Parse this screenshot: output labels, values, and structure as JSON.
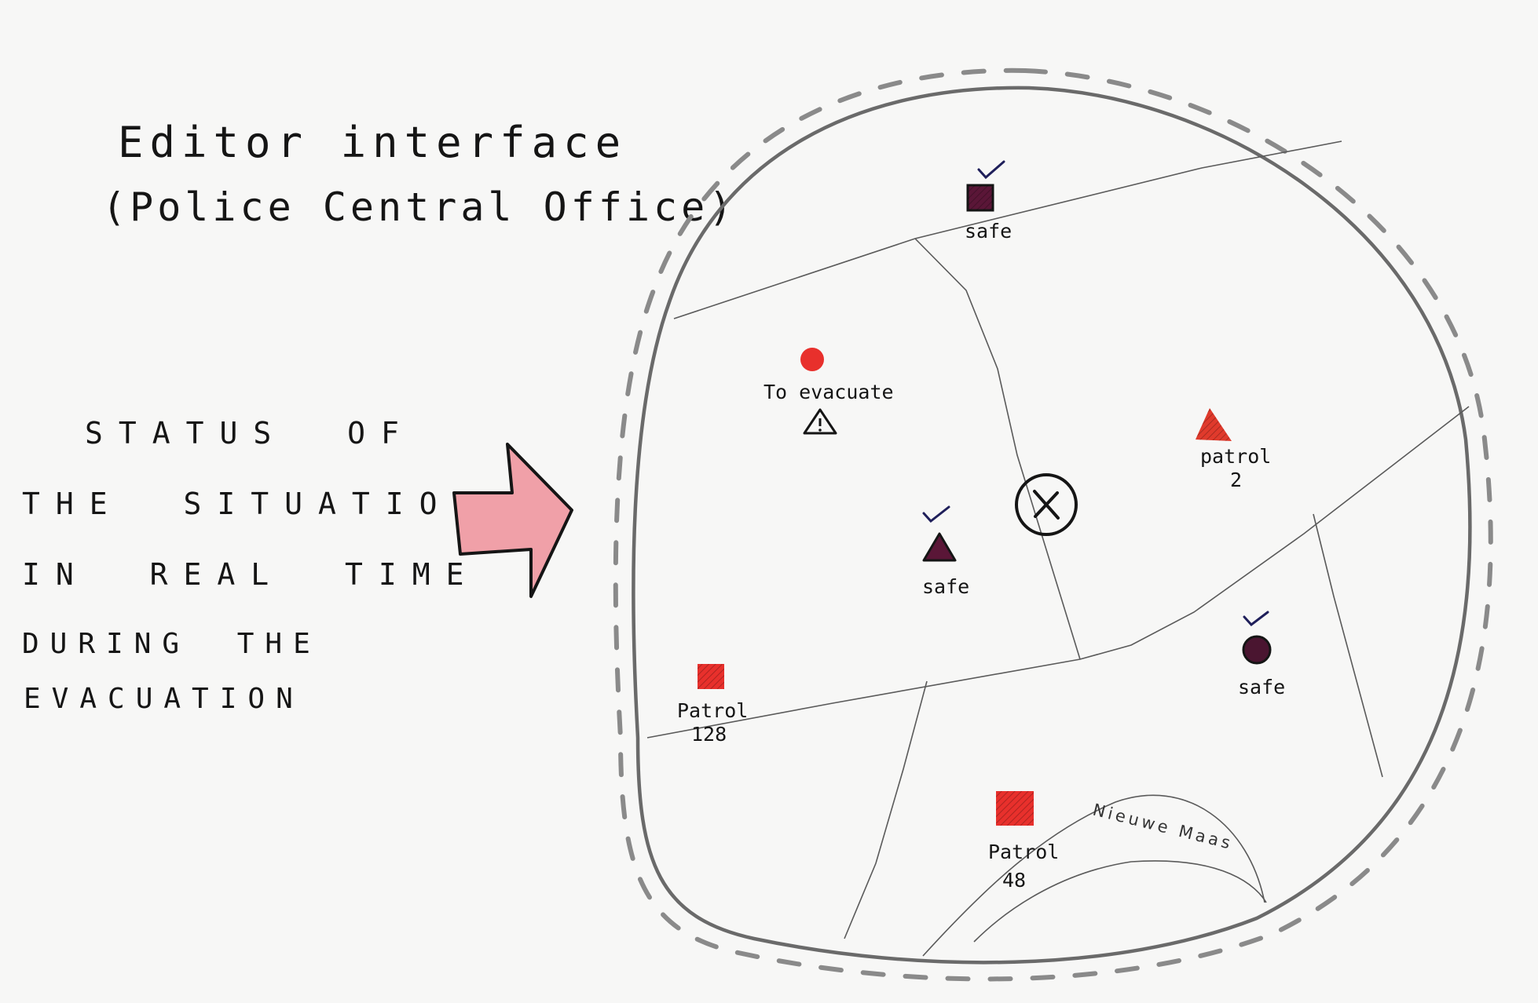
{
  "title": {
    "line1": "Editor interface",
    "line2": "(Police Central Office)"
  },
  "status_text": [
    "STATUS OF",
    "THE SITUATION",
    "IN REAL TIME",
    "DURING THE",
    "EVACUATION"
  ],
  "map": {
    "road_label": "Nieuwe Maas",
    "markers": [
      {
        "id": "safe-top",
        "shape": "square",
        "color": "#5a1637",
        "checked": true,
        "label": [
          "safe"
        ]
      },
      {
        "id": "to-evacuate",
        "shape": "circle",
        "color": "#e8302c",
        "checked": false,
        "warning": true,
        "label": [
          "To evacuate"
        ]
      },
      {
        "id": "patrol-2",
        "shape": "triangle",
        "color": "#e03a2c",
        "checked": false,
        "label": [
          "patrol",
          "2"
        ]
      },
      {
        "id": "safe-center",
        "shape": "triangle",
        "color": "#5a1637",
        "checked": true,
        "label": [
          "safe"
        ]
      },
      {
        "id": "safe-right",
        "shape": "circle",
        "color": "#4a1530",
        "checked": true,
        "label": [
          "safe"
        ]
      },
      {
        "id": "patrol-128",
        "shape": "square",
        "color": "#e8302c",
        "checked": false,
        "label": [
          "Patrol",
          "128"
        ]
      },
      {
        "id": "patrol-48",
        "shape": "square",
        "color": "#e8302c",
        "checked": false,
        "label": [
          "Patrol",
          "48"
        ]
      }
    ],
    "center_icon": "close-x-icon",
    "warning_icon": "warning-icon",
    "check_icon": "check-icon",
    "arrow_color": "#f0a0a8"
  }
}
